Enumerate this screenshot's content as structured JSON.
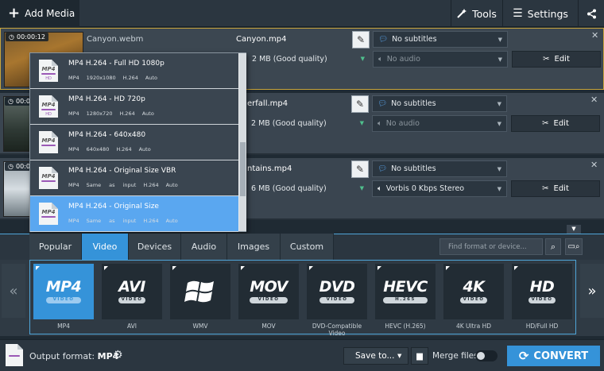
{
  "toolbar": {
    "add_media": "Add Media",
    "tools": "Tools",
    "settings": "Settings"
  },
  "files": [
    {
      "duration": "00:00:12",
      "source_name": "Canyon.webm",
      "output_name": "Canyon.mp4",
      "subtitles": "No subtitles",
      "size_quality": "2 MB (Good quality)",
      "audio": "No audio",
      "edit": "Edit"
    },
    {
      "duration": "00:0",
      "source_name": "",
      "output_name": "erfall.mp4",
      "subtitles": "No subtitles",
      "size_quality": "2 MB (Good quality)",
      "audio": "No audio",
      "edit": "Edit"
    },
    {
      "duration": "00:0",
      "source_name": "",
      "output_name": "ntains.mp4",
      "subtitles": "No subtitles",
      "size_quality": "6 MB (Good quality)",
      "audio": "Vorbis 0 Kbps Stereo",
      "edit": "Edit"
    }
  ],
  "dropdown": {
    "items": [
      {
        "title": "MP4 H.264 - Full HD 1080p",
        "specs": [
          "MP4",
          "1920x1080",
          "H.264",
          "Auto"
        ],
        "icon_label": "HD"
      },
      {
        "title": "MP4 H.264 - HD 720p",
        "specs": [
          "MP4",
          "1280x720",
          "H.264",
          "Auto"
        ],
        "icon_label": "HD"
      },
      {
        "title": "MP4 H.264 - 640x480",
        "specs": [
          "MP4",
          "640x480",
          "H.264",
          "Auto"
        ],
        "icon_label": ""
      },
      {
        "title": "MP4 H.264 - Original Size VBR",
        "specs": [
          "MP4",
          "Same as input",
          "H.264",
          "Auto"
        ],
        "icon_label": ""
      },
      {
        "title": "MP4 H.264 - Original Size",
        "specs": [
          "MP4",
          "Same as input",
          "H.264",
          "Auto"
        ],
        "icon_label": ""
      }
    ],
    "active_index": 4
  },
  "format_tabs": [
    "Popular",
    "Video",
    "Devices",
    "Audio",
    "Images",
    "Custom"
  ],
  "active_tab": "Video",
  "search_placeholder": "Find format or device...",
  "formats": [
    {
      "big": "MP4",
      "sub": "VIDEO",
      "label": "MP4",
      "active": true,
      "icon": "mp4-icon"
    },
    {
      "big": "AVI",
      "sub": "VIDEO",
      "label": "AVI",
      "active": false,
      "icon": "avi-icon"
    },
    {
      "big": "",
      "sub": "",
      "label": "WMV",
      "active": false,
      "icon": "windows-logo-icon"
    },
    {
      "big": "MOV",
      "sub": "VIDEO",
      "label": "MOV",
      "active": false,
      "icon": "mov-icon"
    },
    {
      "big": "DVD",
      "sub": "VIDEO",
      "label": "DVD-Compatible Video",
      "active": false,
      "icon": "dvd-icon"
    },
    {
      "big": "HEVC",
      "sub": "H.265",
      "label": "HEVC (H.265)",
      "active": false,
      "icon": "hevc-icon"
    },
    {
      "big": "4K",
      "sub": "VIDEO",
      "label": "4K Ultra HD",
      "active": false,
      "icon": "4k-icon"
    },
    {
      "big": "HD",
      "sub": "VIDEO",
      "label": "HD/Full HD",
      "active": false,
      "icon": "hd-icon"
    }
  ],
  "bottom": {
    "output_format_label": "Output format:",
    "output_format_value": "MP4",
    "save_to": "Save to...",
    "merge_files": "Merge files:",
    "convert": "CONVERT"
  },
  "colors": {
    "accent": "#3593d9",
    "selected_border": "#c9a43b",
    "highlight": "#5aa7f0"
  }
}
